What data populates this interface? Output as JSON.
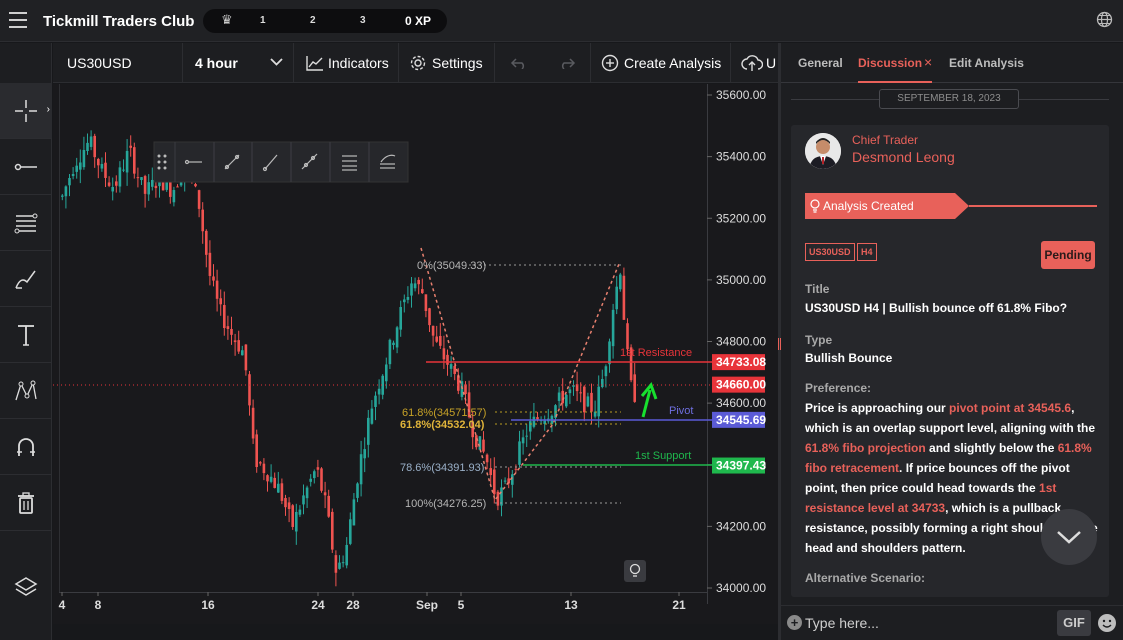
{
  "app": {
    "title": "Tickmill Traders Club"
  },
  "xp_bar": {
    "levels": [
      "1",
      "2",
      "3"
    ],
    "xp": "0 XP"
  },
  "toolbar": {
    "symbol": "US30USD",
    "timeframe": "4 hour",
    "indicators_label": "Indicators",
    "settings_label": "Settings",
    "create_analysis_label": "Create Analysis",
    "upload_label": "U"
  },
  "chart_data": {
    "type": "candlestick",
    "symbol": "US30USD",
    "price_axis": [
      "35600.00",
      "35400.00",
      "35200.00",
      "35000.00",
      "34800.00",
      "34600.00",
      "34400.00",
      "34200.00",
      "34000.00"
    ],
    "date_axis": [
      "4",
      "8",
      "16",
      "24",
      "28",
      "Sep",
      "5",
      "13",
      "21"
    ],
    "price_tags": [
      {
        "value": "34733.08",
        "color": "#e8343a"
      },
      {
        "value": "34660.00",
        "color": "#e8343a"
      },
      {
        "value": "34545.69",
        "color": "#5b5bd6"
      },
      {
        "value": "34397.43",
        "color": "#1fb84d"
      }
    ],
    "fib_labels": [
      {
        "text": "0%(35049.33)",
        "color": "#b5b5b5"
      },
      {
        "text": "61.8%(34571.57)",
        "color": "#c7a227"
      },
      {
        "text": "61.8%(34532.04)",
        "color": "#e0b43a"
      },
      {
        "text": "78.6%(34391.93)",
        "color": "#9ab0c8"
      },
      {
        "text": "100%(34276.25)",
        "color": "#b5b5b5"
      }
    ],
    "level_labels": [
      {
        "text": "1st Resistance",
        "color": "#e8343a"
      },
      {
        "text": "Pivot",
        "color": "#6f6fe0"
      },
      {
        "text": "1st Support",
        "color": "#1fb84d"
      }
    ]
  },
  "panel": {
    "tabs": [
      "General",
      "Discussion",
      "Edit Analysis"
    ],
    "tab_close": "×",
    "date": "SEPTEMBER 18, 2023",
    "author_role": "Chief Trader",
    "author_name": "Desmond Leong",
    "banner": "Analysis Created",
    "tags": [
      "US30USD",
      "H4"
    ],
    "status": "Pending",
    "title_label": "Title",
    "title_value": "US30USD H4 | Bullish bounce off 61.8% Fibo?",
    "type_label": "Type",
    "type_value": "Bullish Bounce",
    "pref_label": "Preference:",
    "pref_parts": [
      {
        "t": "Price is approaching our ",
        "h": false
      },
      {
        "t": "pivot point at 34545.6",
        "h": true
      },
      {
        "t": ", which is an overlap support level, aligning with the ",
        "h": false
      },
      {
        "t": "61.8% fibo projection",
        "h": true
      },
      {
        "t": " and slightly below the ",
        "h": false
      },
      {
        "t": "61.8% fibo retracement",
        "h": true
      },
      {
        "t": ". If price bounces off the pivot point, then price could head towards the ",
        "h": false
      },
      {
        "t": "1st resistance level at 34733",
        "h": true
      },
      {
        "t": ", which is a pullback resistance, possibly forming a right shoulder of the head and shoulders pattern.",
        "h": false
      }
    ],
    "alt_label": "Alternative Scenario:",
    "input_placeholder": "Type here...",
    "gif_label": "GIF"
  },
  "colors": {
    "accent": "#e8615a",
    "up": "#26a69a",
    "down": "#ef5350"
  }
}
